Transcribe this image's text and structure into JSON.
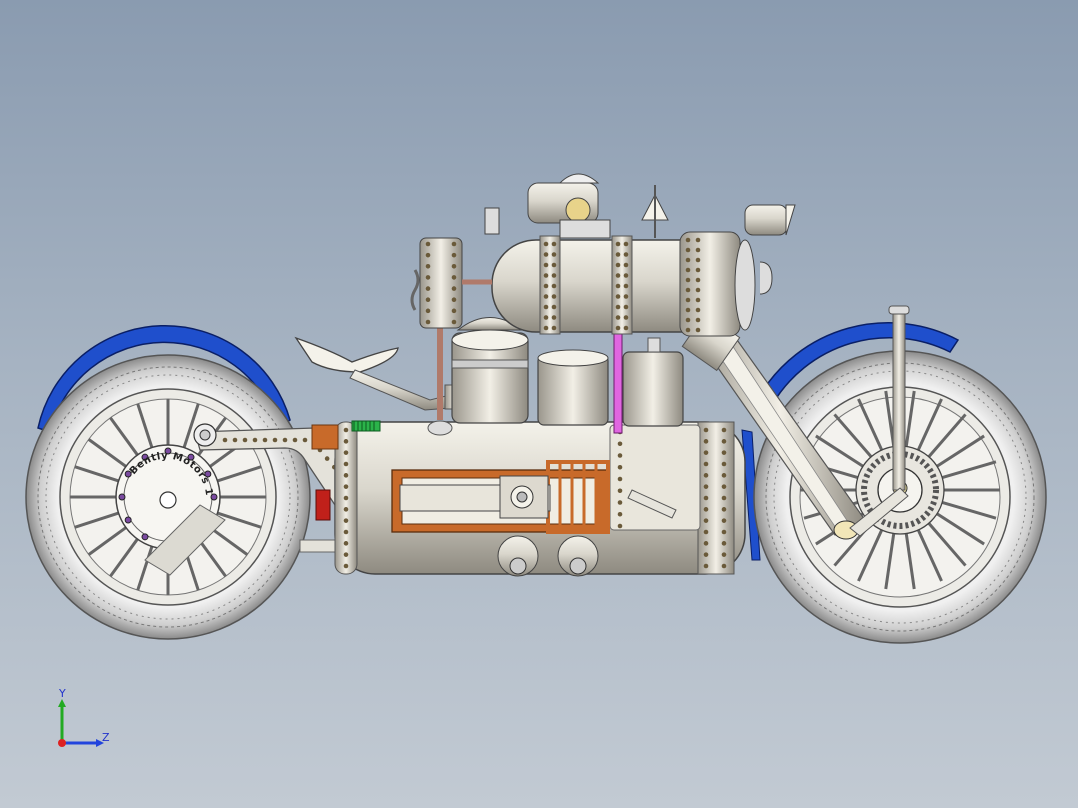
{
  "viewport": {
    "background_top": "#8a9bb0",
    "background_bottom": "#c2cad3"
  },
  "model": {
    "hub_text": "Bently Motors 1882",
    "colors": {
      "metal": "#d9d6cc",
      "tire": "#cfcfcf",
      "fender": "#1f4fcc",
      "frame": "#e4e2da",
      "copper": "#c86a2a",
      "pipe_pink": "#e066e0",
      "pipe_brown": "#b07a6a",
      "green_coil": "#2bb34a",
      "red_part": "#c0201a"
    }
  },
  "triad": {
    "y_label": "Y",
    "z_label": "Z",
    "y_color": "#22aa22",
    "z_color": "#2244dd",
    "x_color": "#dd2222"
  }
}
